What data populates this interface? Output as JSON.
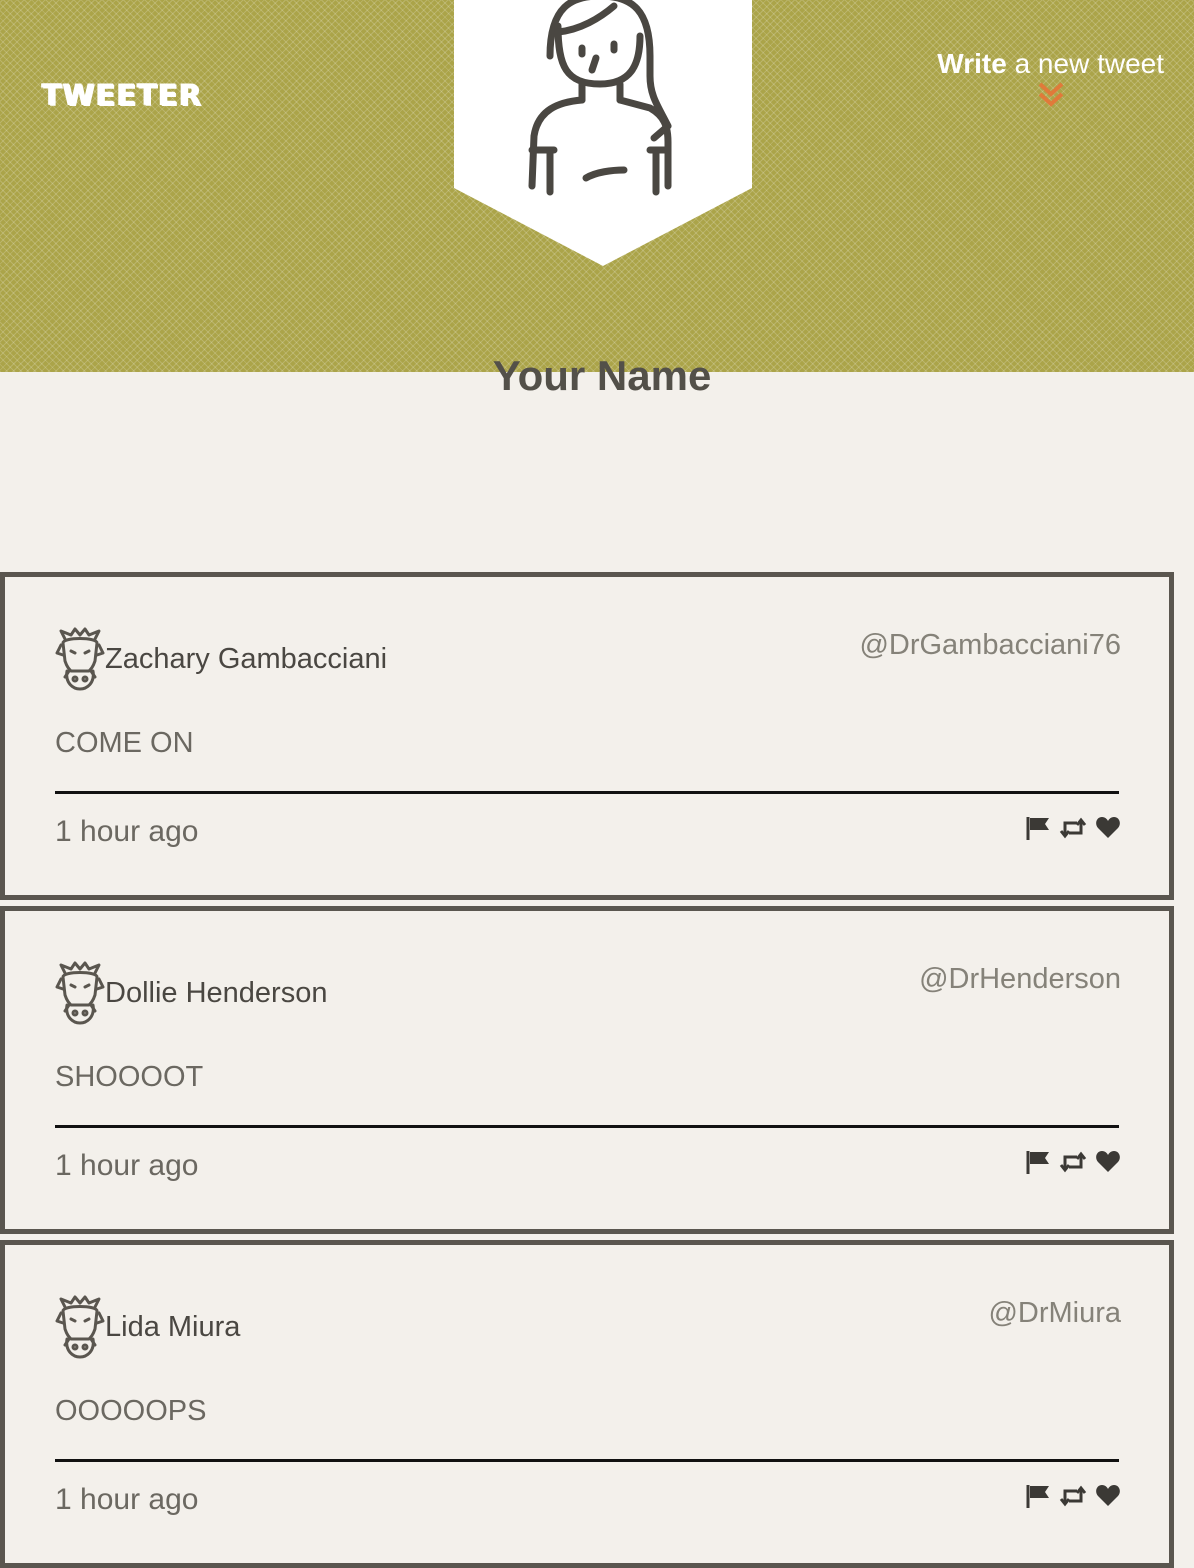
{
  "header": {
    "brand": "TWEETER",
    "write_link": {
      "strong": "Write",
      "rest": " a new tweet"
    }
  },
  "profile": {
    "name": "Your Name"
  },
  "colors": {
    "header_bg": "#aba449",
    "accent": "#e07a3a",
    "page_bg": "#f3f0eb",
    "text_dark": "#535049"
  },
  "tweets": [
    {
      "author": "Zachary Gambacciani",
      "handle": "@DrGambacciani76",
      "text": "COME ON",
      "time": "1 hour ago"
    },
    {
      "author": "Dollie Henderson",
      "handle": "@DrHenderson",
      "text": "SHOOOOT",
      "time": "1 hour ago"
    },
    {
      "author": "Lida Miura",
      "handle": "@DrMiura",
      "text": "OOOOOPS",
      "time": "1 hour ago"
    }
  ],
  "icons": {
    "avatar": "user-avatar-icon",
    "author": "boar-avatar-icon",
    "flag": "flag-icon",
    "retweet": "retweet-icon",
    "like": "heart-icon",
    "chevron": "chevron-double-down-icon"
  }
}
